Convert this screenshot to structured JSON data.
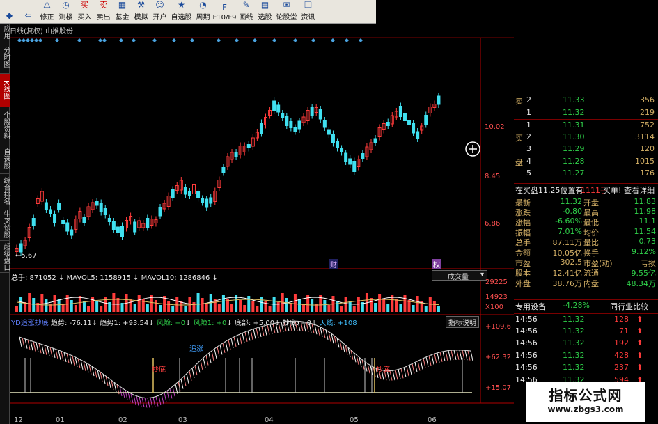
{
  "toolbar": {
    "items": [
      {
        "label": "",
        "icon": "logo-icon"
      },
      {
        "label": "",
        "icon": "back-arrow-icon"
      },
      {
        "label": "修正",
        "icon": "warning-icon"
      },
      {
        "label": "测楼",
        "icon": "clock-icon"
      },
      {
        "label": "买入",
        "icon": "buy-icon"
      },
      {
        "label": "卖出",
        "icon": "sell-icon"
      },
      {
        "label": "基金",
        "icon": "fund-icon"
      },
      {
        "label": "模拟",
        "icon": "hammer-icon"
      },
      {
        "label": "开户",
        "icon": "person-icon"
      },
      {
        "label": "自选股",
        "icon": "bookmark-icon"
      },
      {
        "label": "周期",
        "icon": "cycle-icon"
      },
      {
        "label": "F10/F9",
        "icon": "f10-icon"
      },
      {
        "label": "画线",
        "icon": "draw-icon"
      },
      {
        "label": "选股",
        "icon": "filter-icon"
      },
      {
        "label": "论股堂",
        "icon": "chat-icon"
      },
      {
        "label": "资讯",
        "icon": "news-icon"
      }
    ]
  },
  "chart_title": "日线(复权) 山推股份",
  "left_tabs": [
    {
      "label": "应用"
    },
    {
      "label": "分时图"
    },
    {
      "label": "K线图",
      "active": true
    },
    {
      "label": "个股资料"
    },
    {
      "label": "自选股"
    },
    {
      "label": "综合排名"
    },
    {
      "label": "牛叉诊股"
    },
    {
      "label": "超级盘口"
    }
  ],
  "price_axis": {
    "labels": [
      "10.02",
      "8.45",
      "6.86"
    ]
  },
  "price_chart_marks": {
    "low_label": "5.67",
    "fin_label": "财",
    "ex_label": "权"
  },
  "volume_header": {
    "total": "总手: 871052",
    "mavol5": "MAVOL5: 1158915",
    "mavol10": "MAVOL10: 1286846",
    "dropdown": "成交量",
    "axis": [
      "29225",
      "14923",
      "X100"
    ]
  },
  "indicator_header": {
    "name": "YD追涨抄底",
    "trend_label": "趋势: -76.11",
    "trend1": "趋势1: +93.54",
    "risk": "风险: +0",
    "risk1": "风险1: +0",
    "bottom": "底部: +5.00",
    "chaodi": "抄底: +0",
    "tianxian": "天线: +108",
    "help": "指标说明",
    "axis": [
      "+109.6",
      "+62.32",
      "+15.07"
    ],
    "chaodi_marks": [
      "抄底",
      "追涨",
      "抄底"
    ]
  },
  "x_axis_labels": [
    "12",
    "01",
    "02",
    "03",
    "04",
    "05",
    "06"
  ],
  "order_book": {
    "rows": [
      {
        "side": "卖",
        "level": "2",
        "price": "11.33",
        "vol": "356"
      },
      {
        "side": "",
        "level": "1",
        "price": "11.32",
        "vol": "219"
      },
      {
        "side": "",
        "level": "1",
        "price": "11.31",
        "vol": "752"
      },
      {
        "side": "买",
        "level": "2",
        "price": "11.30",
        "vol": "3114"
      },
      {
        "side": "",
        "level": "3",
        "price": "11.29",
        "vol": "120"
      },
      {
        "side": "盘",
        "level": "4",
        "price": "11.28",
        "vol": "1015"
      },
      {
        "side": "",
        "level": "5",
        "price": "11.27",
        "vol": "176"
      }
    ],
    "info": "在买盘11.25位置有",
    "info_vol": "1111手",
    "info_buy": "买单!",
    "info_detail": "查看详细"
  },
  "quote_stats": [
    {
      "l1": "最新",
      "v1": "11.32",
      "l2": "开盘",
      "v2": "11.83"
    },
    {
      "l1": "涨跌",
      "v1": "-0.80",
      "l2": "最高",
      "v2": "11.98"
    },
    {
      "l1": "涨幅",
      "v1": "-6.60%",
      "l2": "最低",
      "v2": "11.1"
    },
    {
      "l1": "振幅",
      "v1": "7.01%",
      "l2": "均价",
      "v2": "11.54"
    },
    {
      "l1": "总手",
      "v1": "87.11万",
      "l2": "量比",
      "v2": "0.73"
    },
    {
      "l1": "金额",
      "v1": "10.05亿",
      "l2": "换手",
      "v2": "9.12%"
    },
    {
      "l1": "市盈",
      "v1": "302.5",
      "l2": "市盈(动)",
      "v2": "亏损"
    },
    {
      "l1": "股本",
      "v1": "12.41亿",
      "l2": "流通",
      "v2": "9.55亿"
    },
    {
      "l1": "外盘",
      "v1": "38.76万",
      "l2": "内盘",
      "v2": "48.34万"
    }
  ],
  "sector": {
    "name": "专用设备",
    "change": "-4.28%",
    "compare": "同行业比较"
  },
  "ticks": [
    {
      "time": "14:56",
      "price": "11.32",
      "vol": "128",
      "dir": "up"
    },
    {
      "time": "14:56",
      "price": "11.32",
      "vol": "71",
      "dir": "up"
    },
    {
      "time": "14:56",
      "price": "11.32",
      "vol": "192",
      "dir": "up"
    },
    {
      "time": "14:56",
      "price": "11.32",
      "vol": "428",
      "dir": "up"
    },
    {
      "time": "14:56",
      "price": "11.32",
      "vol": "237",
      "dir": "up"
    },
    {
      "time": "14:56",
      "price": "11.32",
      "vol": "594",
      "dir": "up"
    }
  ],
  "watermark": {
    "title": "指标公式网",
    "url": "www.zbgs3.com"
  },
  "colors": {
    "up": "#ff3b3b",
    "down": "#40e0f0",
    "axis": "#b00000",
    "gold": "#d4b066",
    "green": "#2fd14a"
  }
}
